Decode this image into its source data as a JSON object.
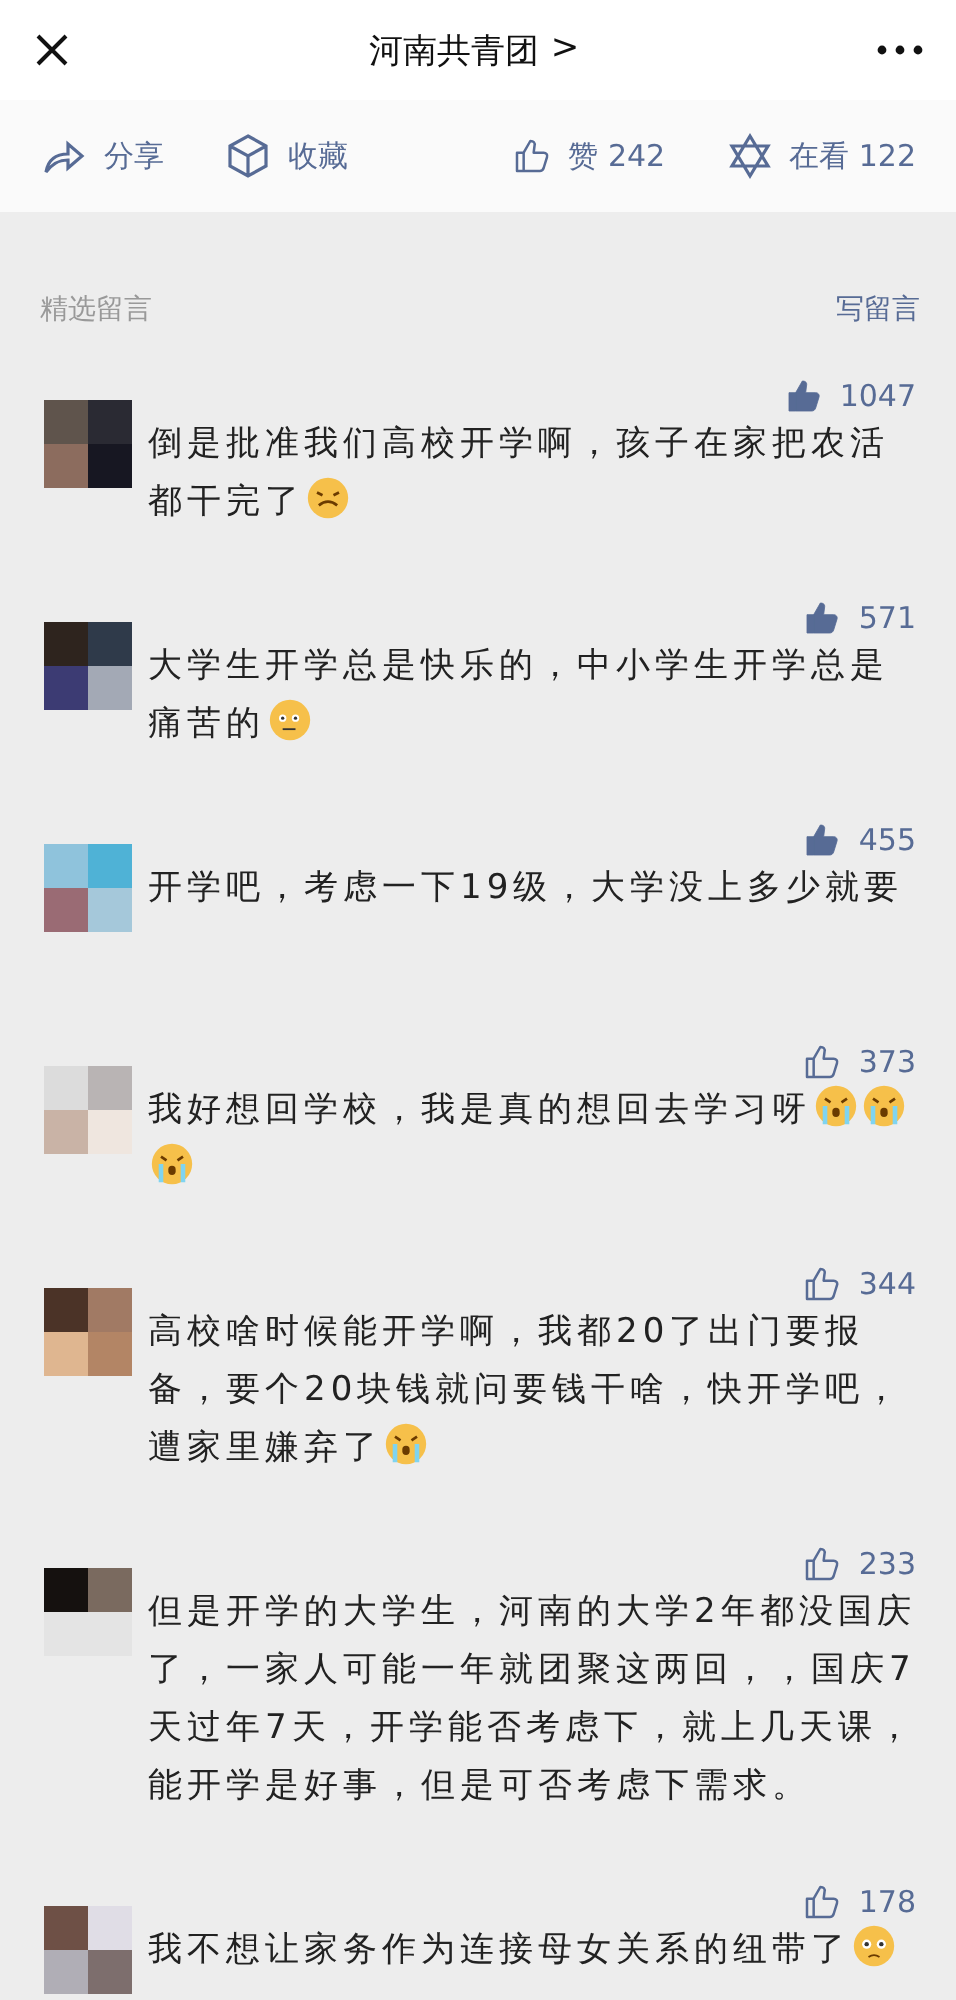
{
  "header": {
    "title": "河南共青团",
    "chevron": ">"
  },
  "actions": [
    {
      "kind": "share",
      "label": "分享"
    },
    {
      "kind": "collect",
      "label": "收藏"
    },
    {
      "kind": "like",
      "label": "赞 242"
    },
    {
      "kind": "watching",
      "label": "在看 122"
    }
  ],
  "comments_header": {
    "title": "精选留言",
    "write": "写留言"
  },
  "comments": [
    {
      "likes": "1047",
      "liked": true,
      "text": "倒是批准我们高校开学啊，孩子在家把农活都干完了",
      "emojis": [
        {
          "kind": "grimace"
        }
      ]
    },
    {
      "likes": "571",
      "liked": true,
      "text": "大学生开学总是快乐的，中小学生开学总是痛苦的",
      "emojis": [
        {
          "kind": "doge"
        }
      ]
    },
    {
      "likes": "455",
      "liked": true,
      "text": "开学吧，考虑一下19级，大学没上多少就要"
    },
    {
      "likes": "373",
      "liked": false,
      "text": "我好想回学校，我是真的想回去学习呀",
      "emojis": [
        {
          "kind": "crying"
        },
        {
          "kind": "crying"
        },
        {
          "kind": "crying"
        }
      ]
    },
    {
      "likes": "344",
      "liked": false,
      "text": "高校啥时候能开学啊，我都20了出门要报备，要个20块钱就问要钱干啥，快开学吧，遭家里嫌弃了",
      "emojis": [
        {
          "kind": "crying"
        }
      ]
    },
    {
      "likes": "233",
      "liked": false,
      "text": "但是开学的大学生，河南的大学2年都没国庆了，一家人可能一年就团聚这两回，，国庆7天过年7天，开学能否考虑下，就上几天课，能开学是好事，但是可否考虑下需求。"
    },
    {
      "likes": "178",
      "liked": false,
      "text": "我不想让家务作为连接母女关系的纽带了",
      "emojis": [
        {
          "kind": "teary"
        }
      ]
    }
  ]
}
